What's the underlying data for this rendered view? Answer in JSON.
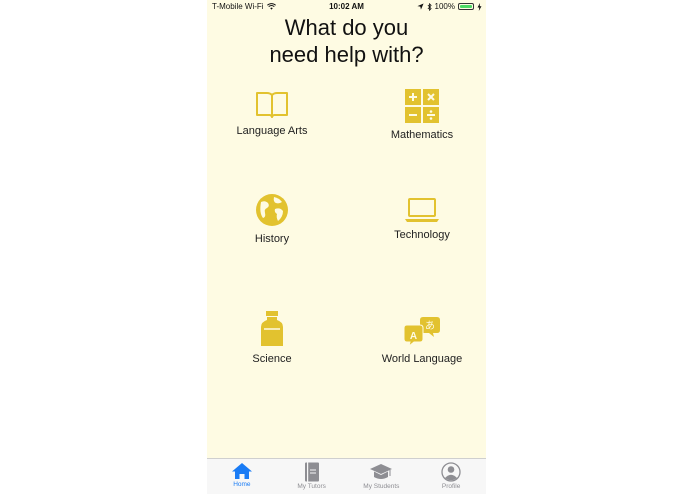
{
  "status_bar": {
    "carrier": "T-Mobile Wi-Fi",
    "time": "10:02 AM",
    "battery": "100%"
  },
  "headline": {
    "line1": "What do you",
    "line2": "need help with?"
  },
  "subjects": [
    {
      "label": "Language Arts",
      "icon": "open-book-icon"
    },
    {
      "label": "Mathematics",
      "icon": "calculator-icon"
    },
    {
      "label": "History",
      "icon": "globe-icon"
    },
    {
      "label": "Technology",
      "icon": "laptop-icon"
    },
    {
      "label": "Science",
      "icon": "beaker-icon"
    },
    {
      "label": "World Language",
      "icon": "translate-icon"
    }
  ],
  "tabs": [
    {
      "label": "Home",
      "icon": "home-icon",
      "active": true
    },
    {
      "label": "My Tutors",
      "icon": "book-icon",
      "active": false
    },
    {
      "label": "My Students",
      "icon": "graduation-cap-icon",
      "active": false
    },
    {
      "label": "Profile",
      "icon": "user-icon",
      "active": false
    }
  ],
  "colors": {
    "background": "#fefbe3",
    "accent": "#e2c22f",
    "tab_active": "#1a7cf5",
    "tab_inactive": "#8e8e93"
  }
}
